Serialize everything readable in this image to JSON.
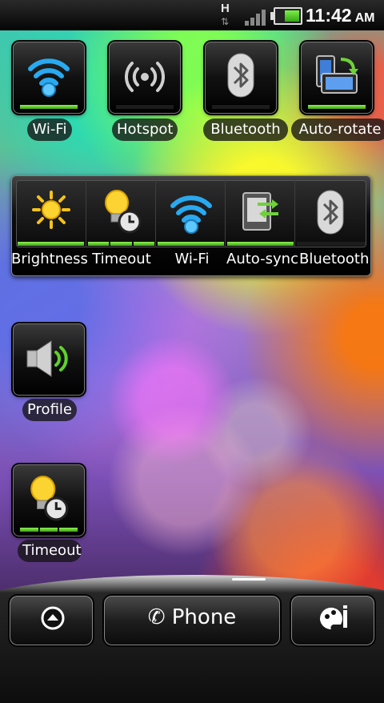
{
  "status_bar": {
    "network_type": "H",
    "network_arrows": "⇅",
    "time": "11:42",
    "ampm": "AM"
  },
  "widgets": [
    {
      "label": "Wi-Fi",
      "icon": "wifi-icon",
      "state": "on"
    },
    {
      "label": "Hotspot",
      "icon": "hotspot-icon",
      "state": "off"
    },
    {
      "label": "Bluetooth",
      "icon": "bluetooth-icon",
      "state": "off"
    },
    {
      "label": "Auto-rotate",
      "icon": "auto-rotate-icon",
      "state": "on"
    },
    {
      "label": "Profile",
      "icon": "speaker-icon",
      "state": "on"
    },
    {
      "label": "Timeout",
      "icon": "timeout-icon",
      "state": "segmented"
    }
  ],
  "power_bar": {
    "items": [
      {
        "label": "Brightness",
        "icon": "brightness-icon",
        "state": "on"
      },
      {
        "label": "Timeout",
        "icon": "timeout-icon",
        "state": "segmented"
      },
      {
        "label": "Wi-Fi",
        "icon": "wifi-icon",
        "state": "on"
      },
      {
        "label": "Auto-sync",
        "icon": "auto-sync-icon",
        "state": "on"
      },
      {
        "label": "Bluetooth",
        "icon": "bluetooth-icon",
        "state": "off"
      }
    ]
  },
  "dock": {
    "left_icon": "app-drawer-icon",
    "phone_glyph": "✆",
    "phone_label": "Phone",
    "right_icon": "personalize-icon"
  },
  "colors": {
    "indicator_on": "#5fd12e",
    "wifi_blue": "#29a9f0"
  }
}
